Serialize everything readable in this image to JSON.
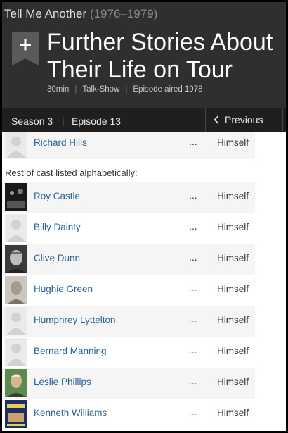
{
  "header": {
    "show_title": "Tell Me Another",
    "show_years": "(1976–1979)",
    "episode_title": "Further Stories About Their Life on Tour",
    "runtime": "30min",
    "genre": "Talk-Show",
    "aired": "Episode aired 1978",
    "add_icon": "bookmark-plus-icon"
  },
  "nav": {
    "season": "Season 3",
    "episode": "Episode 13",
    "previous": "Previous"
  },
  "cast": {
    "first": {
      "name": "Richard Hills",
      "dots": "...",
      "role": "Himself"
    },
    "rest_label": "Rest of cast listed alphabetically:",
    "members": [
      {
        "name": "Roy Castle",
        "dots": "...",
        "role": "Himself",
        "photo": "dark"
      },
      {
        "name": "Billy Dainty",
        "dots": "...",
        "role": "Himself",
        "photo": "placeholder"
      },
      {
        "name": "Clive Dunn",
        "dots": "...",
        "role": "Himself",
        "photo": "bw"
      },
      {
        "name": "Hughie Green",
        "dots": "...",
        "role": "Himself",
        "photo": "sepia"
      },
      {
        "name": "Humphrey Lyttelton",
        "dots": "...",
        "role": "Himself",
        "photo": "placeholder"
      },
      {
        "name": "Bernard Manning",
        "dots": "...",
        "role": "Himself",
        "photo": "placeholder"
      },
      {
        "name": "Leslie Phillips",
        "dots": "...",
        "role": "Himself",
        "photo": "color"
      },
      {
        "name": "Kenneth Williams",
        "dots": "...",
        "role": "Himself",
        "photo": "poster"
      }
    ]
  },
  "colors": {
    "header_bg": "#2f2f2f",
    "link": "#2a6496",
    "nav_bg": "#1f1f1f"
  }
}
